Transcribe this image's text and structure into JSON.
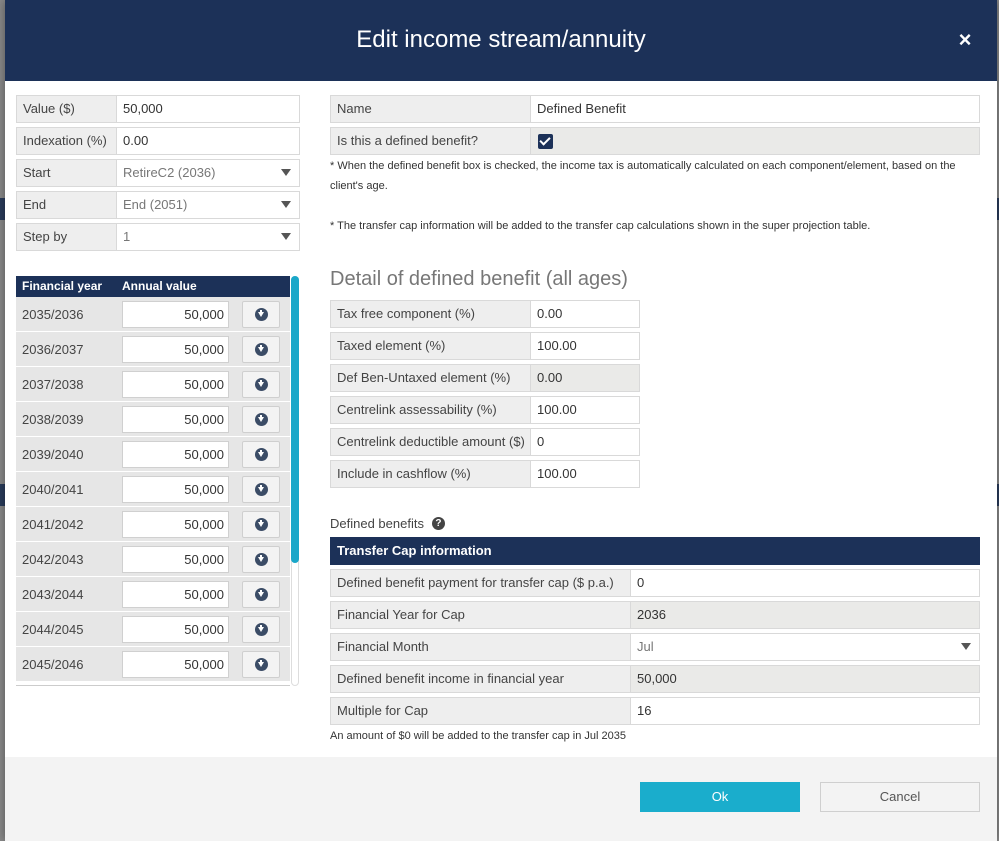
{
  "dialog": {
    "title": "Edit income stream/annuity",
    "close_glyph": "×"
  },
  "left_fields": {
    "value": {
      "label": "Value ($)",
      "value": "50,000"
    },
    "indexation": {
      "label": "Indexation (%)",
      "value": "0.00"
    },
    "start": {
      "label": "Start",
      "value": "RetireC2 (2036)"
    },
    "end": {
      "label": "End",
      "value": "End (2051)"
    },
    "step_by": {
      "label": "Step by",
      "value": "1"
    }
  },
  "fy_table": {
    "col_year": "Financial year",
    "col_value": "Annual value",
    "rows": [
      {
        "year": "2035/2036",
        "value": "50,000"
      },
      {
        "year": "2036/2037",
        "value": "50,000"
      },
      {
        "year": "2037/2038",
        "value": "50,000"
      },
      {
        "year": "2038/2039",
        "value": "50,000"
      },
      {
        "year": "2039/2040",
        "value": "50,000"
      },
      {
        "year": "2040/2041",
        "value": "50,000"
      },
      {
        "year": "2041/2042",
        "value": "50,000"
      },
      {
        "year": "2042/2043",
        "value": "50,000"
      },
      {
        "year": "2043/2044",
        "value": "50,000"
      },
      {
        "year": "2044/2045",
        "value": "50,000"
      },
      {
        "year": "2045/2046",
        "value": "50,000"
      }
    ]
  },
  "right_top": {
    "name": {
      "label": "Name",
      "value": "Defined Benefit"
    },
    "is_defined": {
      "label": "Is this a defined benefit?",
      "checked": true
    },
    "note1": "* When the defined benefit box is checked, the income tax is automatically calculated on each component/element, based on the client's age.",
    "note2": "* The transfer cap information will be added to the transfer cap calculations shown in the super projection table."
  },
  "detail": {
    "title": "Detail of defined benefit (all ages)",
    "tax_free": {
      "label": "Tax free component (%)",
      "value": "0.00"
    },
    "taxed": {
      "label": "Taxed element (%)",
      "value": "100.00"
    },
    "untaxed": {
      "label": "Def Ben-Untaxed element (%)",
      "value": "0.00"
    },
    "centrelink_assess": {
      "label": "Centrelink assessability (%)",
      "value": "100.00"
    },
    "centrelink_deduct": {
      "label": "Centrelink deductible amount ($)",
      "value": "0"
    },
    "cashflow": {
      "label": "Include in cashflow (%)",
      "value": "100.00"
    }
  },
  "transfer_cap": {
    "section_label": "Defined benefits",
    "header": "Transfer Cap information",
    "payment": {
      "label": "Defined benefit payment for transfer cap ($ p.a.)",
      "value": "0"
    },
    "fy_cap": {
      "label": "Financial Year for Cap",
      "value": "2036"
    },
    "month": {
      "label": "Financial Month",
      "value": "Jul"
    },
    "income_fy": {
      "label": "Defined benefit income in financial year",
      "value": "50,000"
    },
    "multiple": {
      "label": "Multiple for Cap",
      "value": "16"
    },
    "footer_note": "An amount of $0 will be added to the transfer cap in Jul 2035"
  },
  "buttons": {
    "ok": "Ok",
    "cancel": "Cancel"
  },
  "colors": {
    "header": "#1c3158",
    "accent": "#1aadcc"
  }
}
